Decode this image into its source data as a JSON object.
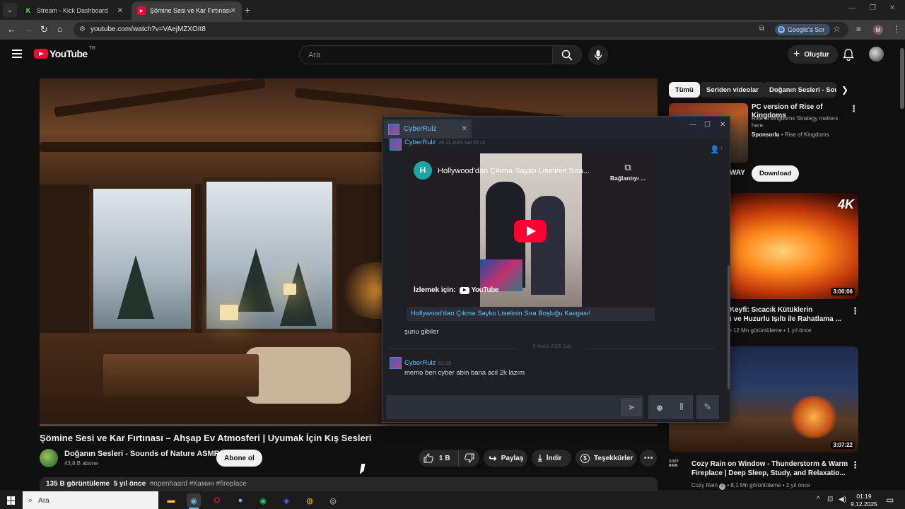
{
  "browser": {
    "tabs": [
      {
        "title": "Stream - Kick Dashboard",
        "active": false
      },
      {
        "title": "Şömine Sesi ve Kar Fırtınası – Ahşap Ev Atmosferi",
        "active": true
      }
    ],
    "url": "youtube.com/watch?v=VAejMZXOIt8",
    "google_ask": "Google'a Sor",
    "profile_initial": "M"
  },
  "yt": {
    "logo_text": "YouTube",
    "region": "TR",
    "search_placeholder": "Ara",
    "create_label": "Oluştur"
  },
  "video": {
    "title": "Şömine Sesi ve Kar Fırtınası – Ahşap Ev Atmosferi | Uyumak İçin Kış Sesleri",
    "channel": "Doğanın Sesleri - Sounds of Nature ASMR",
    "subscribers": "43,8 B abone",
    "subscribe_label": "Abone ol",
    "likes": "1 B",
    "share_label": "Paylaş",
    "download_label": "İndir",
    "thanks_label": "Teşekkürler",
    "views": "135 B görüntüleme",
    "age": "5 yıl önce",
    "tags": "#openhaard #Камин #fireplace",
    "progress": 0.0
  },
  "sidebar": {
    "chips": [
      "Tümü",
      "Seriden videolar",
      "Doğanın Sesleri - Sou"
    ],
    "ad": {
      "title": "PC version of Rise of Kingdoms",
      "desc": "Rise of kingdoms Strategy matters here",
      "sponsored": "Sponsorlu",
      "advertiser": "Rise of Kingdoms",
      "tail_text": "WAY",
      "download_label": "Download"
    },
    "videos": [
      {
        "duration": "3:00:06",
        "badge": "4K",
        "title": "Keyfi: Sıcacık Kütüklerin\nı ve Huzurlu Işıltı ile Rahatlama ...",
        "meta": "• 12 Mn görüntüleme • 1 yıl önce"
      },
      {
        "duration": "3:07:22",
        "title": "Cozy Rain on Window - Thunderstorm & Warm Fireplace | Deep Sleep, Study, and Relaxatio...",
        "channel": "Cozy Rain",
        "meta": "8,1 Mn görüntüleme • 2 yıl önce",
        "channel_logo": "COZY RAIN"
      }
    ]
  },
  "steam_chat": {
    "tab_name": "CyberRulz",
    "messages": [
      {
        "user": "CyberRulz",
        "time": "25.11.2025 Sal 22:12"
      },
      {
        "text": "şunu gibiler"
      },
      {
        "user": "CyberRulz",
        "time": "01:19",
        "text": "memo ben cyber abin bana acil 2k lazım"
      }
    ],
    "embed": {
      "channel_initial": "H",
      "title": "Hollywood'dan Çıkma Sayko Liselinin Sıra...",
      "copy_label": "Bağlantıyı ...",
      "watch_label": "İzlemek için:",
      "yt_label": "YouTube",
      "link_text": "Hollywood'dan Çıkma Sayko Liselinin Sıra Boşluğu Kavgası!"
    },
    "date_divider": "9 Aralık 2025 Salı"
  },
  "taskbar": {
    "search_placeholder": "Ara",
    "time": "01:19",
    "date": "9.12.2025"
  }
}
